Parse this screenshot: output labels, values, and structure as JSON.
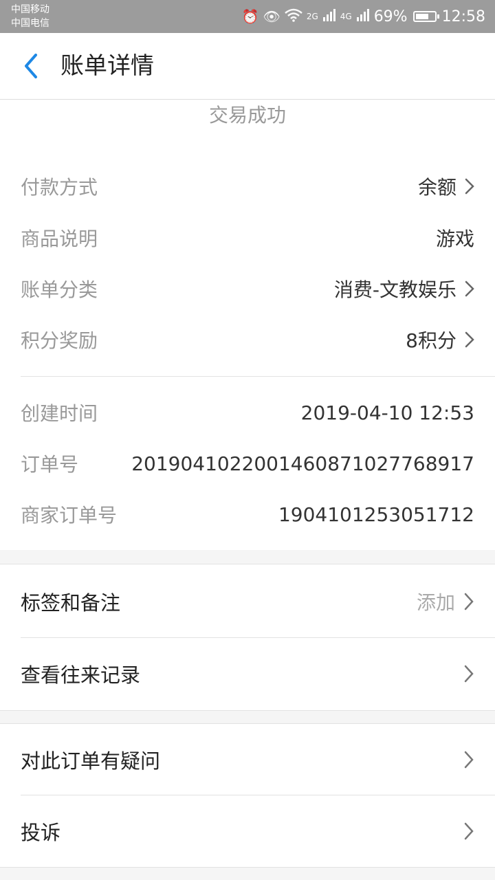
{
  "status_bar": {
    "carrier1": "中国移动",
    "carrier2": "中国电信",
    "net2": "2G",
    "net4": "4G",
    "battery": "69%",
    "time": "12:58"
  },
  "header": {
    "title": "账单详情",
    "back_icon": "chevron-left-icon"
  },
  "status_text": "交易成功",
  "details": [
    {
      "label": "付款方式",
      "value": "余额",
      "chevron": true
    },
    {
      "label": "商品说明",
      "value": "游戏",
      "chevron": false
    },
    {
      "label": "账单分类",
      "value": "消费-文教娱乐",
      "chevron": true
    },
    {
      "label": "积分奖励",
      "value": "8积分",
      "chevron": true
    }
  ],
  "order_info": [
    {
      "label": "创建时间",
      "value": "2019-04-10 12:53"
    },
    {
      "label": "订单号",
      "value": "2019041022001460871027768917"
    },
    {
      "label": "商家订单号",
      "value": "1904101253051712"
    }
  ],
  "actions_group1": [
    {
      "label": "标签和备注",
      "value": "添加"
    },
    {
      "label": "查看往来记录",
      "value": ""
    }
  ],
  "actions_group2": [
    {
      "label": "对此订单有疑问",
      "value": ""
    },
    {
      "label": "投诉",
      "value": ""
    }
  ],
  "colors": {
    "accent": "#1e88e5",
    "status_bar": "#9c9c9c",
    "label_gray": "#999999",
    "background": "#f5f5f5"
  }
}
